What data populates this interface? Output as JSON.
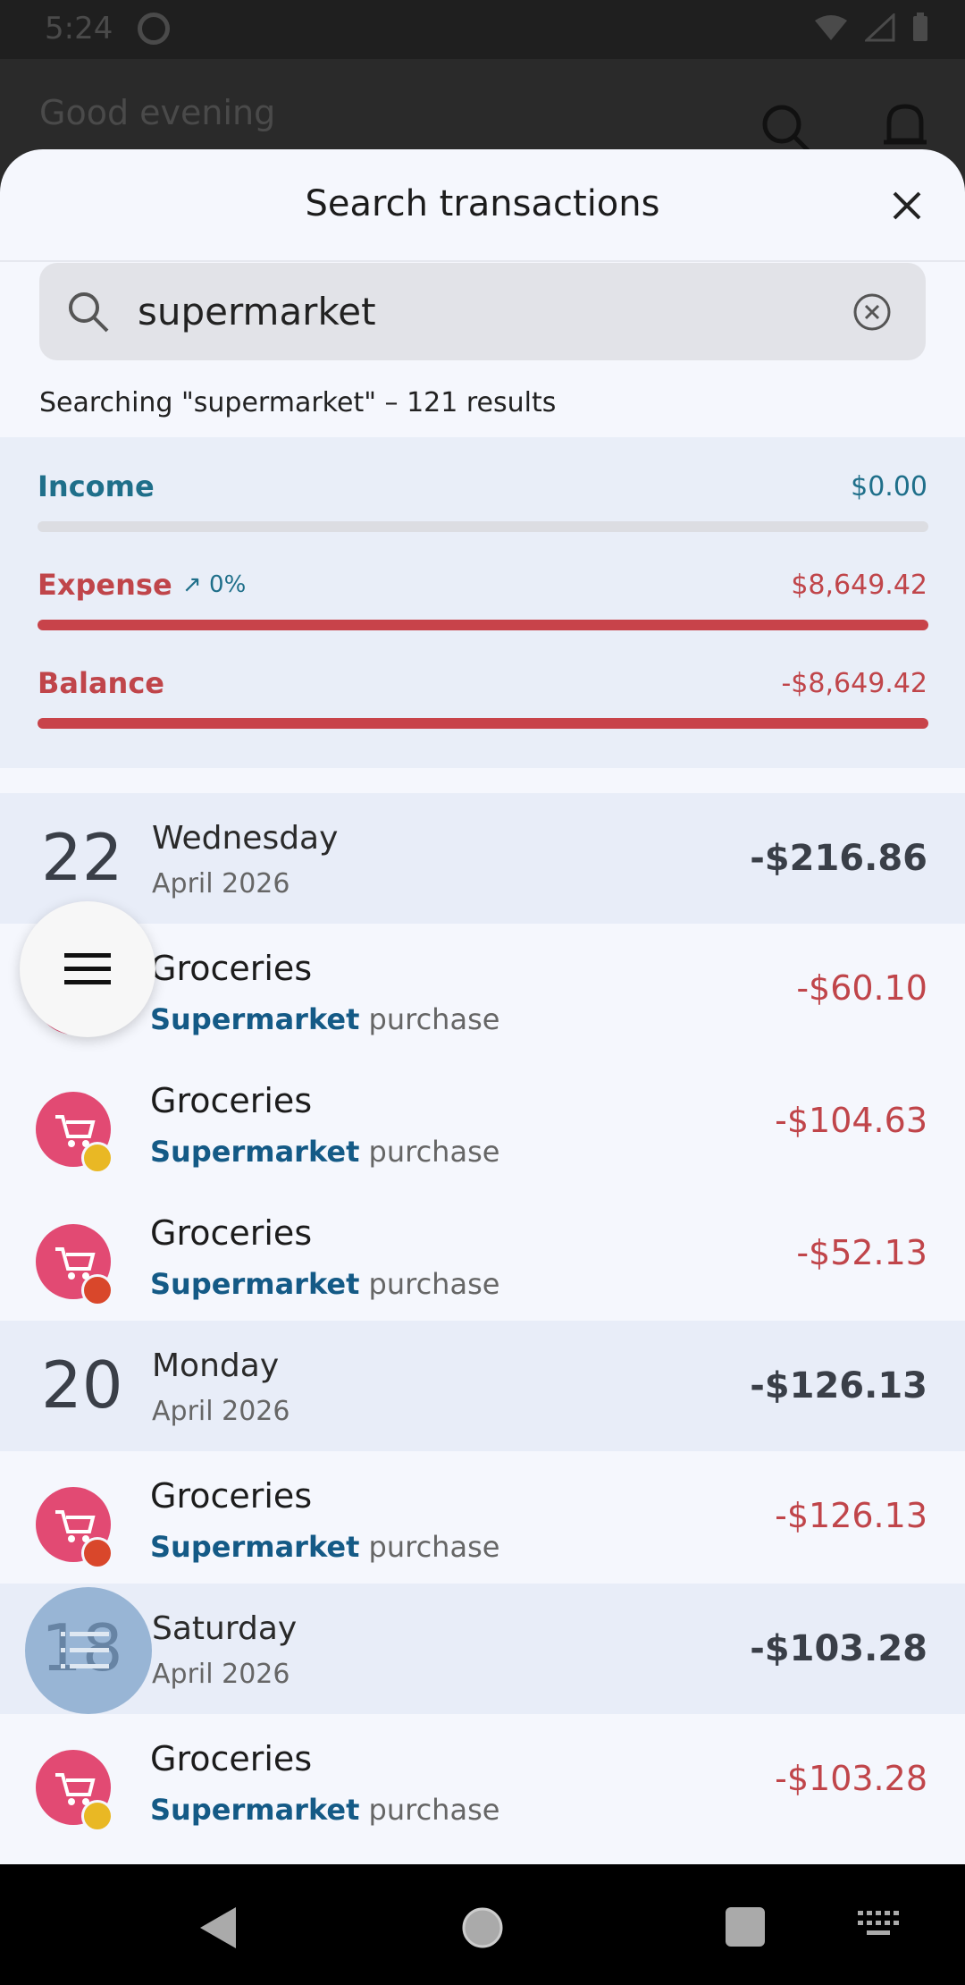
{
  "status": {
    "time": "5:24"
  },
  "background": {
    "greeting": "Good evening"
  },
  "sheet": {
    "title": "Search transactions"
  },
  "search": {
    "value": "supermarket",
    "summary": "Searching \"supermarket\" – 121 results"
  },
  "summary": {
    "income_label": "Income",
    "income_value": "$0.00",
    "expense_label": "Expense",
    "expense_trend": "↗ 0%",
    "expense_value": "$8,649.42",
    "balance_label": "Balance",
    "balance_value": "-$8,649.42"
  },
  "days": [
    {
      "day": "22",
      "weekday": "Wednesday",
      "month": "April 2026",
      "total": "-$216.86",
      "transactions": [
        {
          "category": "Groceries",
          "merchant": "Supermarket",
          "rest": " purchase",
          "amount": "-$60.10",
          "badge": "none"
        },
        {
          "category": "Groceries",
          "merchant": "Supermarket",
          "rest": " purchase",
          "amount": "-$104.63",
          "badge": "cash"
        },
        {
          "category": "Groceries",
          "merchant": "Supermarket",
          "rest": " purchase",
          "amount": "-$52.13",
          "badge": "wallet"
        }
      ]
    },
    {
      "day": "20",
      "weekday": "Monday",
      "month": "April 2026",
      "total": "-$126.13",
      "transactions": [
        {
          "category": "Groceries",
          "merchant": "Supermarket",
          "rest": " purchase",
          "amount": "-$126.13",
          "badge": "wallet"
        }
      ]
    },
    {
      "day": "18",
      "weekday": "Saturday",
      "month": "April 2026",
      "total": "-$103.28",
      "transactions": [
        {
          "category": "Groceries",
          "merchant": "Supermarket",
          "rest": " purchase",
          "amount": "-$103.28",
          "badge": "coin"
        }
      ]
    }
  ],
  "colors": {
    "income": "#1f6f8a",
    "expense": "#c0454a",
    "category_icon": "#e24a73"
  }
}
